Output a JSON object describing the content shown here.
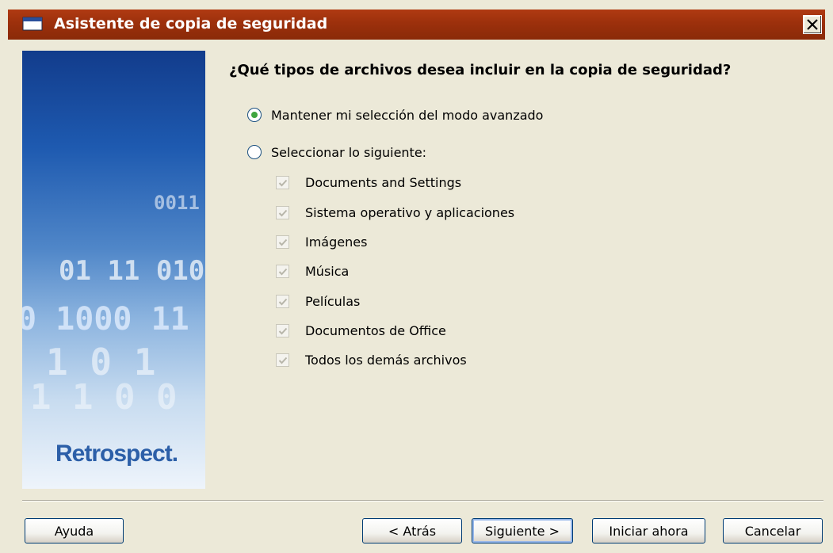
{
  "window": {
    "title": "Asistente de copia de seguridad",
    "titlebar_color": "#9c300c"
  },
  "sidebar": {
    "binary_lines": [
      "0011",
      "01 11 010",
      "0 1000 11",
      "1 0 1",
      "1 1 0 0"
    ],
    "brand": "Retrospect."
  },
  "main": {
    "question": "¿Qué tipos de archivos desea incluir en la copia de seguridad?",
    "options": [
      {
        "label": "Mantener mi selección del modo avanzado",
        "selected": true
      },
      {
        "label": "Seleccionar lo siguiente:",
        "selected": false
      }
    ],
    "categories": [
      {
        "label": "Documents and Settings",
        "checked": true,
        "enabled": false
      },
      {
        "label": "Sistema operativo y aplicaciones",
        "checked": true,
        "enabled": false
      },
      {
        "label": "Imágenes",
        "checked": true,
        "enabled": false
      },
      {
        "label": "Música",
        "checked": true,
        "enabled": false
      },
      {
        "label": "Películas",
        "checked": true,
        "enabled": false
      },
      {
        "label": "Documentos de Office",
        "checked": true,
        "enabled": false
      },
      {
        "label": "Todos los demás archivos",
        "checked": true,
        "enabled": false
      }
    ]
  },
  "footer": {
    "help_label": "Ayuda",
    "back_label": "< Atrás",
    "next_label": "Siguiente >",
    "start_label": "Iniciar ahora",
    "cancel_label": "Cancelar"
  }
}
